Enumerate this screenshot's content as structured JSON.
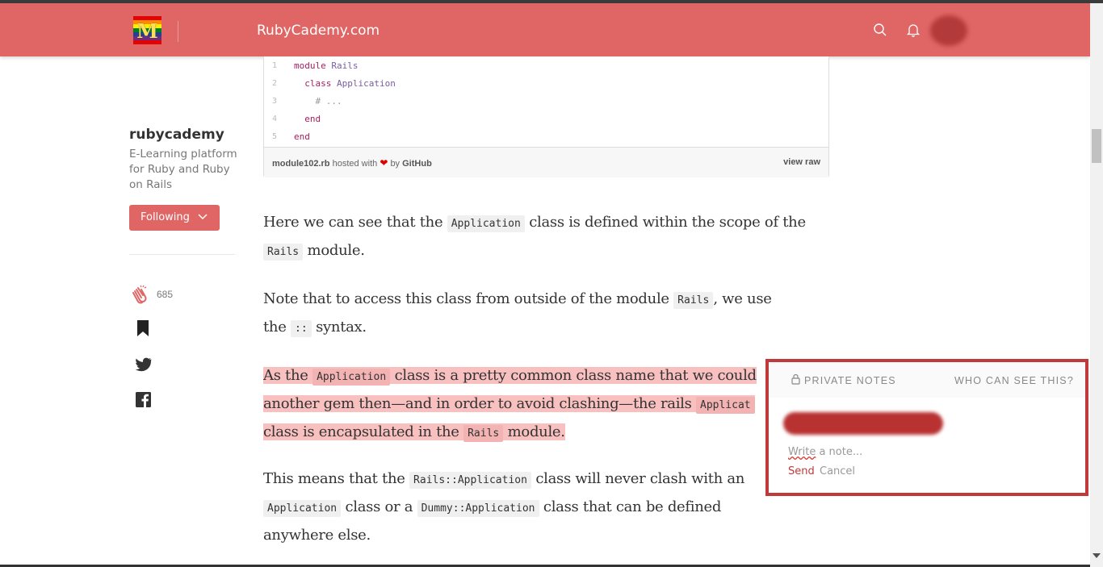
{
  "header": {
    "logo_letter": "M",
    "site_title": "RubyCademy.com",
    "search_icon": "search-icon",
    "bell_icon": "bell-icon",
    "bg": "#e06666"
  },
  "gist": {
    "lines": [
      {
        "n": "1",
        "kw": "module",
        "name": "Rails",
        "indent": ""
      },
      {
        "n": "2",
        "kw": "class",
        "name": "Application",
        "indent": "  "
      },
      {
        "n": "3",
        "comment": "# ...",
        "indent": "    "
      },
      {
        "n": "4",
        "kw": "end",
        "indent": "  "
      },
      {
        "n": "5",
        "kw": "end",
        "indent": ""
      }
    ],
    "file": "module102.rb",
    "hosted": "hosted with",
    "by": "by",
    "github": "GitHub",
    "view_raw": "view raw"
  },
  "author": {
    "name": "rubycademy",
    "desc": "E-Learning platform for Ruby and Ruby on Rails",
    "follow_label": "Following"
  },
  "claps": "685",
  "article": {
    "p1": {
      "a": "Here we can see that the ",
      "code1": "Application",
      "b": " class is defined within the scope of the ",
      "code2": "Rails",
      "c": " module."
    },
    "p2": {
      "a": "Note that to access this class from outside of the module ",
      "code1": "Rails",
      "b": ", we use the ",
      "code2": "::",
      "c": " syntax."
    },
    "p3": {
      "a": "As the ",
      "code1": "Application",
      "b": " class is a pretty common class name that we could",
      "c": "another gem then—and in order to avoid clashing—the rails ",
      "code2": "Applicat",
      "d": "class is encapsulated in the ",
      "code3": "Rails",
      "e": " module."
    },
    "p4": {
      "a": "This means that the ",
      "code1": "Rails::Application",
      "b": " class will never clash with an",
      "code2": "Application",
      "c": " class or a ",
      "code3": "Dummy::Application",
      "d": " class that can be defined anywhere else."
    }
  },
  "notes": {
    "title": "PRIVATE NOTES",
    "who": "WHO CAN SEE THIS?",
    "placeholder_a": "Write",
    "placeholder_b": " a note...",
    "send": "Send",
    "cancel": "Cancel",
    "accent": "#c0393b"
  }
}
